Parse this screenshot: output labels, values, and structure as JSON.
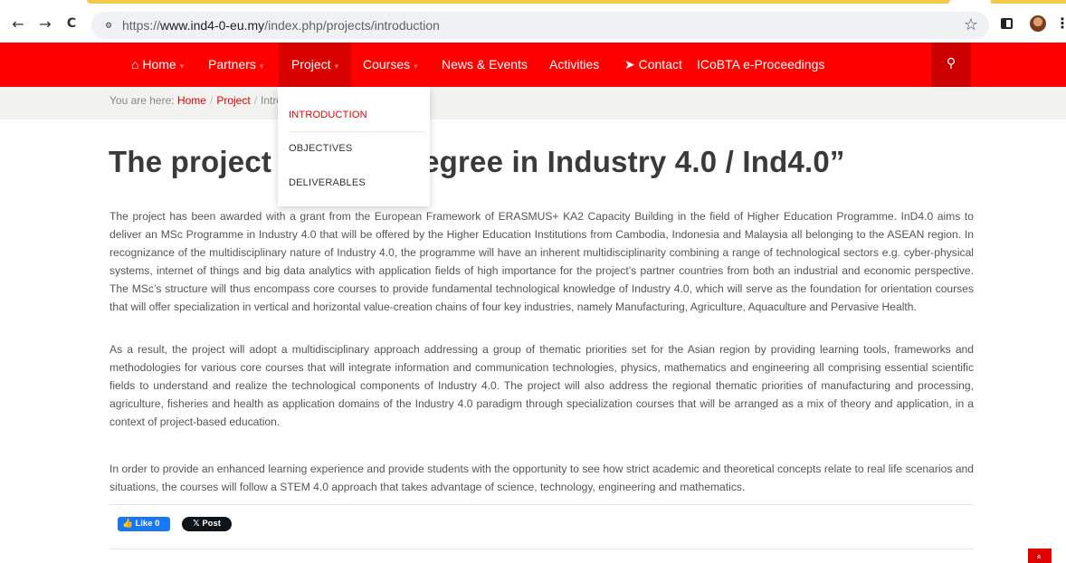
{
  "browser": {
    "back_icon": "←",
    "forward_icon": "→",
    "reload_icon": "C",
    "site_info_icon": "⚙",
    "url_prefix": "https://",
    "url_host": "www.ind4-0-eu.my",
    "url_path": "/index.php/projects/introduction",
    "bookmark_icon": "☆",
    "menu_icon": "⋮"
  },
  "nav": {
    "home": "Home",
    "home_icon": "⌂",
    "partners": "Partners",
    "project": "Project",
    "courses": "Courses",
    "news": "News & Events",
    "activities": "Activities",
    "contact": "Contact",
    "contact_icon": "➤",
    "icobta": "ICoBTA e-Proceedings",
    "search_icon": "⚲"
  },
  "breadcrumb": {
    "prefix": "You are here:",
    "home": "Home",
    "project": "Project",
    "current": "Introduction"
  },
  "dropdown": {
    "items": [
      "INTRODUCTION",
      "OBJECTIVES",
      "DELIVERABLES"
    ]
  },
  "page": {
    "title": "The project “Master Degree in Industry 4.0 / Ind4.0”",
    "paragraphs": [
      "The project has been awarded with a grant from the European Framework of ERASMUS+ KA2 Capacity Building in the field of Higher Education Programme. InD4.0 aims to deliver an MSc Programme in Industry 4.0 that will be offered by the Higher Education Institutions from Cambodia, Indonesia and Malaysia all belonging to the ASEAN region. In recognizance of the multidisciplinary nature of Industry 4.0, the programme will have an inherent multidisciplinarity combining a range of technological sectors e.g. cyber-physical systems, internet of things and big data analytics  with application fields of high importance for the project’s partner countries from both an industrial and economic perspective. The MSc’s structure will thus encompass core courses to provide fundamental technological knowledge of Industry 4.0, which will serve as the foundation for orientation courses that will offer specialization in vertical and horizontal value-creation chains of four key industries, namely Manufacturing, Agriculture, Aquaculture and Pervasive Health.",
      "As a result, the project will adopt a multidisciplinary approach addressing a group of thematic priorities set for the Asian region by providing learning tools, frameworks and methodologies for various core courses that will integrate information and communication technologies, physics, mathematics and engineering all comprising essential scientific fields to understand and realize the technological components of Industry 4.0. The project will also address the regional thematic priorities of manufacturing and processing, agriculture, fisheries and health as application domains of the Industry 4.0 paradigm through specialization courses that will be arranged as a mix of theory and application, in a context of project-based education.",
      "In order to provide an enhanced learning experience and provide students with the opportunity to see how strict academic and theoretical concepts relate to real life scenarios and situations, the courses will follow a STEM 4.0 approach that takes advantage of science, technology, engineering and mathematics."
    ]
  },
  "social": {
    "like_label": "Like 0",
    "like_icon": "👍",
    "post_label": "𝕏 Post"
  },
  "scroll_top_icon": "»",
  "colors": {
    "brand_red": "#ff0000",
    "active_red": "#d90000",
    "link_red": "#e00000"
  }
}
